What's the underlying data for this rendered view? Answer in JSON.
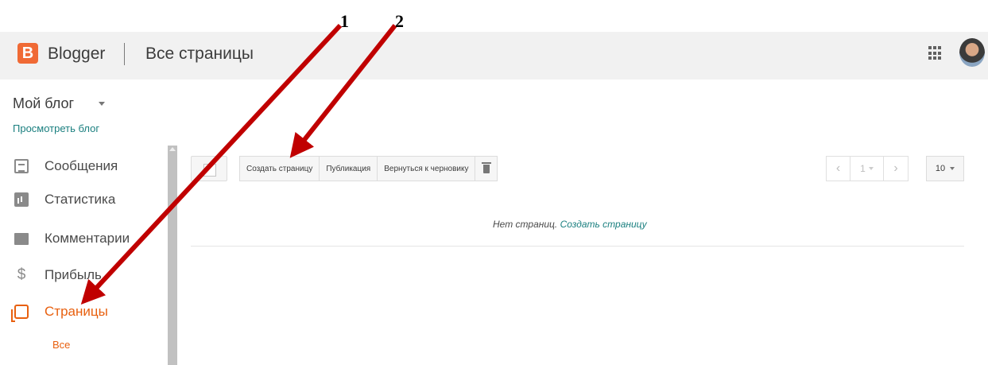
{
  "header": {
    "logo_letter": "B",
    "app_name": "Blogger",
    "page_title": "Все страницы"
  },
  "sidebar": {
    "blog_name": "Мой блог",
    "view_blog": "Просмотреть блог",
    "items": [
      {
        "label": "Сообщения",
        "icon": "posts-icon"
      },
      {
        "label": "Статистика",
        "icon": "stats-icon"
      },
      {
        "label": "Комментарии",
        "icon": "comments-icon"
      },
      {
        "label": "Прибыль",
        "icon": "dollar-icon",
        "glyph": "$"
      },
      {
        "label": "Страницы",
        "icon": "pages-icon",
        "active": true
      }
    ],
    "sub_item": "Все"
  },
  "toolbar": {
    "create_page": "Создать страницу",
    "publish": "Публикация",
    "revert_draft": "Вернуться к черновику"
  },
  "pager": {
    "prev": "‹",
    "page": "1",
    "next": "›",
    "per_page": "10"
  },
  "content": {
    "empty_text": "Нет страниц.",
    "empty_link": "Создать страницу"
  },
  "annotations": {
    "marker_1": "1",
    "marker_2": "2",
    "arrow_color": "#c00000"
  },
  "colors": {
    "accent": "#e8600f",
    "link": "#1a7f7f",
    "logo": "#f06a35"
  }
}
